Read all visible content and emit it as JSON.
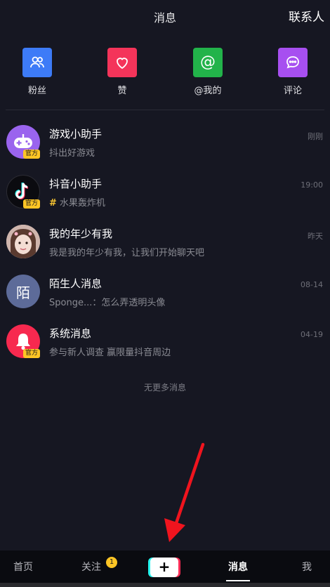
{
  "header": {
    "title": "消息",
    "contacts": "联系人"
  },
  "quick_actions": [
    {
      "label": "粉丝",
      "icon": "fans-icon",
      "color": "#3d7bf7"
    },
    {
      "label": "赞",
      "icon": "heart-icon",
      "color": "#f4345a"
    },
    {
      "label": "@我的",
      "icon": "at-icon",
      "color": "#22b34a"
    },
    {
      "label": "评论",
      "icon": "comment-icon",
      "color": "#a74ff0"
    }
  ],
  "messages": [
    {
      "name": "游戏小助手",
      "preview": "抖出好游戏",
      "time": "刚刚",
      "badge": "官方"
    },
    {
      "name": "抖音小助手",
      "preview": "水果轰炸机",
      "hash": "#",
      "time": "19:00",
      "badge": "官方"
    },
    {
      "name": "我的年少有我",
      "preview": "我是我的年少有我，让我们开始聊天吧",
      "time": "昨天"
    },
    {
      "name": "陌生人消息",
      "preview": "Sponge...：怎么弄透明头像",
      "time": "08-14",
      "avatar_text": "陌"
    },
    {
      "name": "系统消息",
      "preview": "参与新人调查 赢限量抖音周边",
      "time": "04-19",
      "badge": "官方"
    }
  ],
  "no_more": "无更多消息",
  "bottom_nav": {
    "home": "首页",
    "follow": "关注",
    "follow_badge": "1",
    "plus": "+",
    "messages": "消息",
    "me": "我"
  }
}
